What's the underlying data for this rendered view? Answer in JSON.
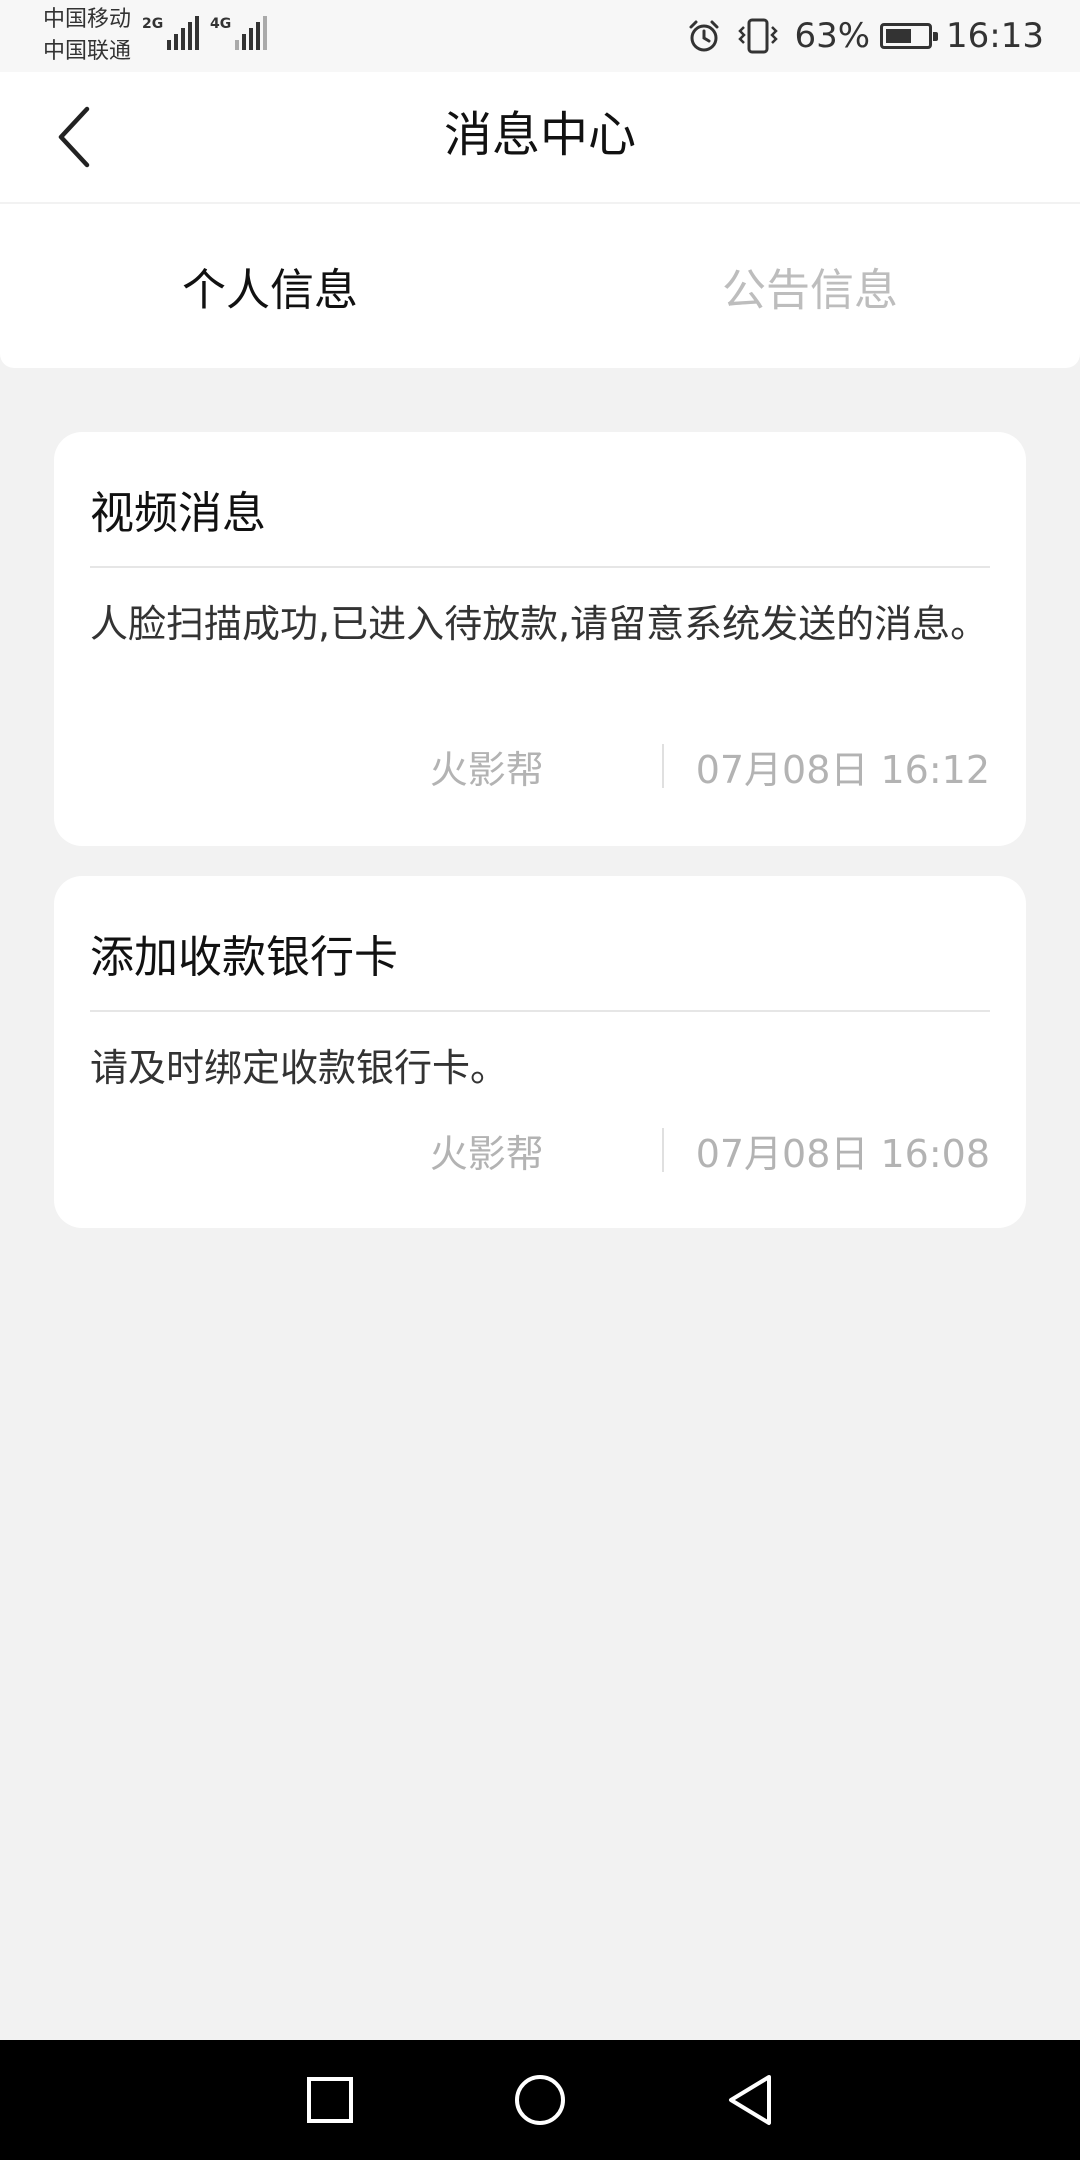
{
  "status_bar": {
    "carrier_1": "中国移动",
    "carrier_2": "中国联通",
    "network_1": "2G",
    "network_2": "4G",
    "battery_percent_label": "63%",
    "battery_level": 0.63,
    "time": "16:13",
    "icons": [
      "alarm-icon",
      "vibrate-icon",
      "battery-icon"
    ]
  },
  "header": {
    "title": "消息中心",
    "back_icon": "chevron-left-icon"
  },
  "tabs": [
    {
      "label": "个人信息",
      "active": true
    },
    {
      "label": "公告信息",
      "active": false
    }
  ],
  "messages": [
    {
      "title": "视频消息",
      "content": "人脸扫描成功,已进入待放款,请留意系统发送的消息。",
      "source": "火影帮",
      "time": "07月08日 16:12"
    },
    {
      "title": "添加收款银行卡",
      "content": "请及时绑定收款银行卡。",
      "source": "火影帮",
      "time": "07月08日 16:08"
    }
  ],
  "nav_bar": {
    "icons": [
      "recent-apps-icon",
      "home-icon",
      "back-icon"
    ]
  },
  "colors": {
    "background": "#f2f2f2",
    "card": "#ffffff",
    "text_primary": "#111111",
    "text_muted": "#b3b3b3",
    "tab_inactive": "#bdbdbd",
    "nav_bar": "#000000"
  }
}
